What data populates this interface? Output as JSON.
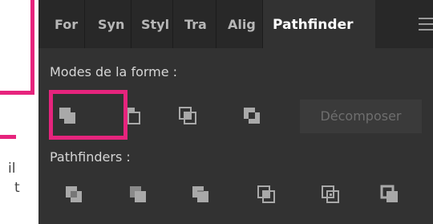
{
  "tabs": [
    "For",
    "Syn",
    "Styl",
    "Tra",
    "Alig"
  ],
  "active_tab": "Pathfinder",
  "menu_icon": "hamburger-menu-icon",
  "shape_modes": {
    "label": "Modes de la forme :",
    "buttons": [
      "unite-icon",
      "minus-front-icon",
      "intersect-icon",
      "exclude-icon"
    ],
    "expand_label": "Décomposer"
  },
  "pathfinders": {
    "label": "Pathfinders :",
    "buttons": [
      "divide-icon",
      "trim-icon",
      "merge-icon",
      "crop-icon",
      "outline-icon",
      "minus-back-icon"
    ]
  },
  "side_text": [
    "il",
    "t"
  ],
  "colors": {
    "highlight": "#e6247d",
    "panel": "#323232",
    "tabbar": "#282828"
  }
}
